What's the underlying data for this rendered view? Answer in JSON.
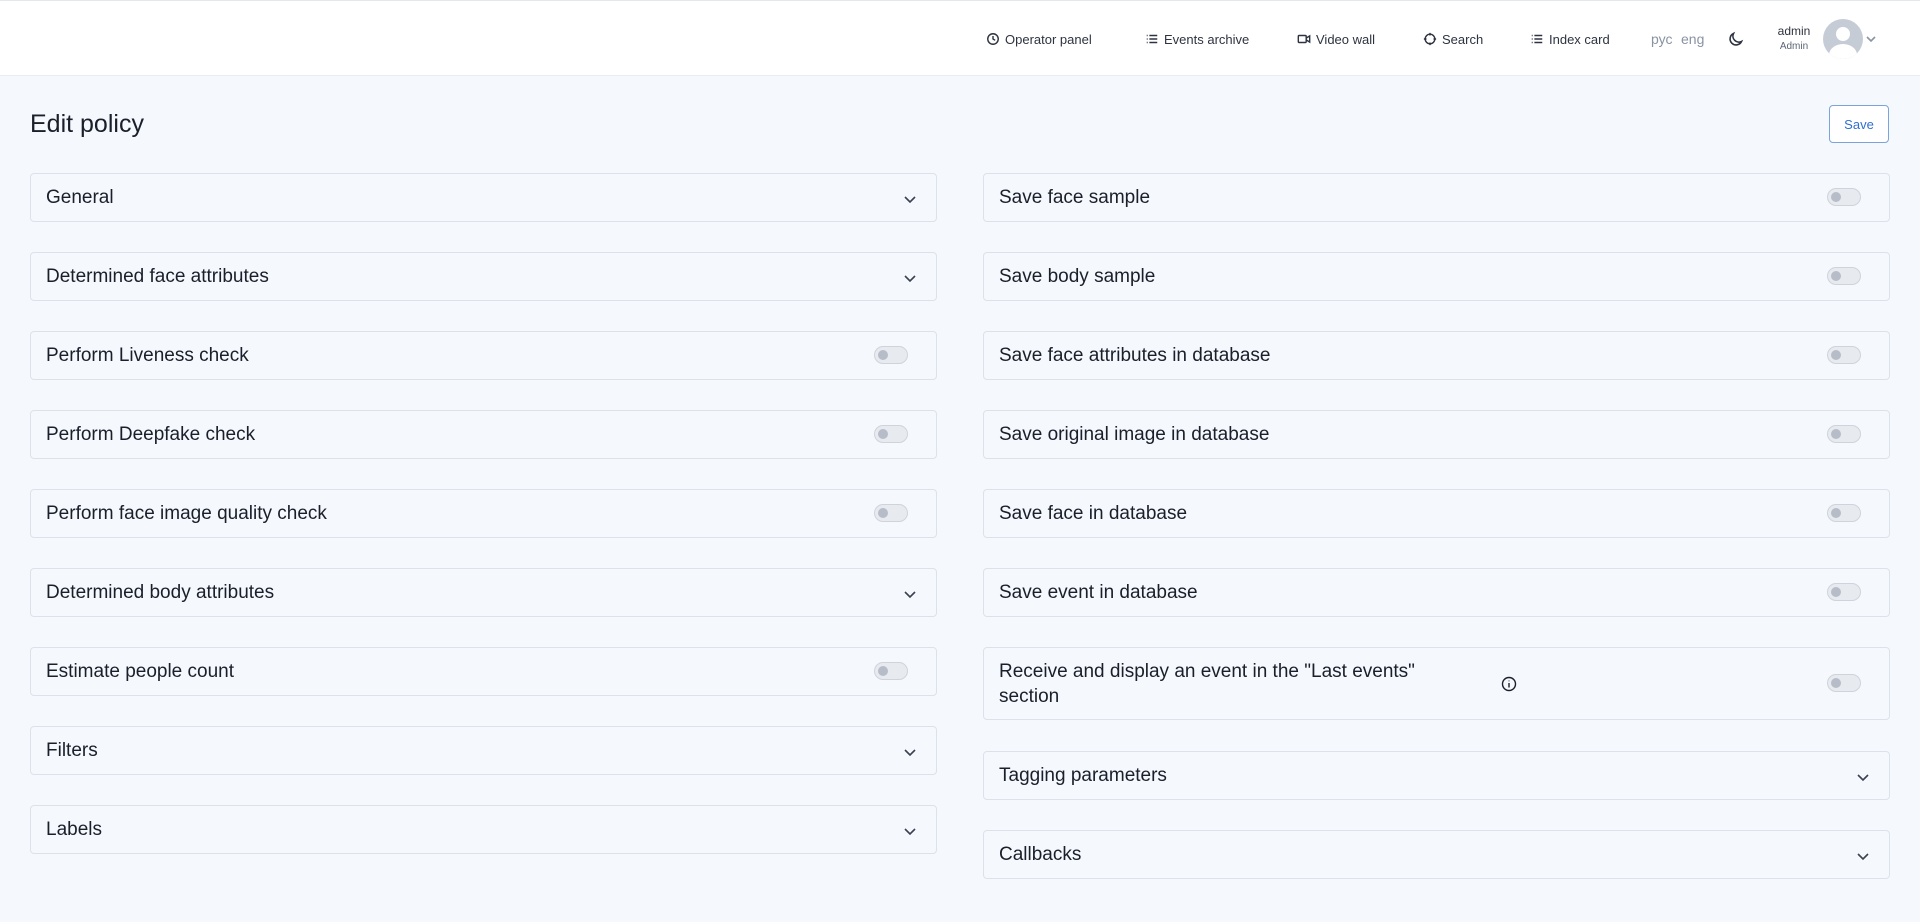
{
  "header": {
    "nav": [
      {
        "label": "Operator panel",
        "icon": "clock-icon"
      },
      {
        "label": "Events archive",
        "icon": "list-icon"
      },
      {
        "label": "Video wall",
        "icon": "video-camera-icon"
      },
      {
        "label": "Search",
        "icon": "crosshair-icon"
      },
      {
        "label": "Index card",
        "icon": "list-icon"
      }
    ],
    "languages": [
      "рус",
      "eng"
    ],
    "user": {
      "name": "admin",
      "role": "Admin"
    }
  },
  "page": {
    "title": "Edit policy",
    "save_label": "Save"
  },
  "left_sections": [
    {
      "label": "General",
      "control": "expand"
    },
    {
      "label": "Determined face attributes",
      "control": "expand"
    },
    {
      "label": "Perform Liveness check",
      "control": "toggle",
      "enabled": false
    },
    {
      "label": "Perform Deepfake check",
      "control": "toggle",
      "enabled": false
    },
    {
      "label": "Perform face image quality check",
      "control": "toggle",
      "enabled": false
    },
    {
      "label": "Determined body attributes",
      "control": "expand"
    },
    {
      "label": "Estimate people count",
      "control": "toggle",
      "enabled": false
    },
    {
      "label": "Filters",
      "control": "expand"
    },
    {
      "label": "Labels",
      "control": "expand"
    }
  ],
  "right_sections": [
    {
      "label": "Save face sample",
      "control": "toggle",
      "enabled": false
    },
    {
      "label": "Save body sample",
      "control": "toggle",
      "enabled": false
    },
    {
      "label": "Save face attributes in database",
      "control": "toggle",
      "enabled": false
    },
    {
      "label": "Save original image in database",
      "control": "toggle",
      "enabled": false
    },
    {
      "label": "Save face in database",
      "control": "toggle",
      "enabled": false
    },
    {
      "label": "Save event in database",
      "control": "toggle",
      "enabled": false
    },
    {
      "label": "Receive and display an event in the \"Last events\" section",
      "control": "toggle",
      "enabled": false,
      "info_icon": "info-icon"
    },
    {
      "label": "Tagging parameters",
      "control": "expand"
    },
    {
      "label": "Callbacks",
      "control": "expand"
    }
  ],
  "colors": {
    "background": "#f5f8fc",
    "accent": "#2f6fd0",
    "toggle_off": "#e7eaef"
  }
}
